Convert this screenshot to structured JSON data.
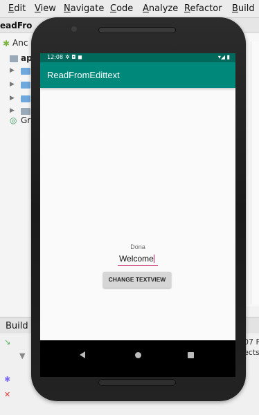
{
  "ide": {
    "menu": [
      "Edit",
      "View",
      "Navigate",
      "Code",
      "Analyze",
      "Refactor",
      "Build"
    ],
    "project_title": "eadFro",
    "tree": [
      {
        "label": "Anc"
      },
      {
        "label": "ap"
      },
      {
        "label": "Gr"
      }
    ],
    "build_label": "Build",
    "build_output": [
      "07 F",
      "ects/"
    ]
  },
  "device": {
    "status_time": "12:08",
    "status_icons": "✲ ◘ ◼",
    "status_right": "▾◢ ▮",
    "app_title": "ReadFromEdittext",
    "text_view": "Dona",
    "edit_text_value": "Welcome",
    "button_label": "CHANGE TEXTVIEW",
    "nav": [
      "back-icon",
      "home-icon",
      "recents-icon"
    ]
  },
  "colors": {
    "status_bar": "#00695c",
    "app_bar": "#00897b",
    "accent": "#c2185b"
  }
}
